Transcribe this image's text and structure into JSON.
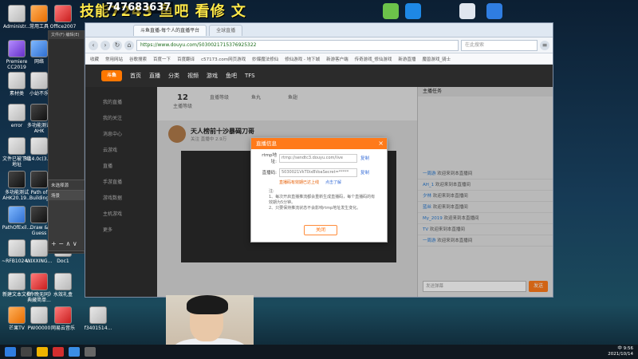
{
  "overlay": {
    "stream_title": "技能7243 鱼吧 看修 文",
    "qq_number": "747683637",
    "room_number": "82563"
  },
  "desktop_icons": [
    {
      "label": "Administr..."
    },
    {
      "label": "常用工具"
    },
    {
      "label": "Office2007"
    },
    {
      "label": "Premiere CC2019"
    },
    {
      "label": "网络"
    },
    {
      "label": "素材类"
    },
    {
      "label": "小幼不乐"
    },
    {
      "label": "error"
    },
    {
      "label": "多功能测试AHK"
    },
    {
      "label": "文件已被下载地址"
    },
    {
      "label": "3.14.0c(3.1...)"
    },
    {
      "label": "多功能测试AHK20.19..."
    },
    {
      "label": "Path of Building"
    },
    {
      "label": "PathOfExil..."
    },
    {
      "label": "Draw & Guess"
    },
    {
      "label": "~RFB1024..."
    },
    {
      "label": "WIXXING..."
    },
    {
      "label": "Doc1"
    },
    {
      "label": "新建文本文档"
    },
    {
      "label": "《今晚无同》典藏简单..."
    },
    {
      "label": "水效礼盒"
    },
    {
      "label": "芒果TV"
    },
    {
      "label": "PW00000"
    },
    {
      "label": "网易云音乐"
    },
    {
      "label": "f3401514..."
    }
  ],
  "browser": {
    "tabs": [
      "斗鱼直播-每个人的直播平台",
      "全球直播"
    ],
    "url": "https://www.douyu.com/5030021715376925322",
    "search_placeholder": "在此搜索",
    "bookmarks": [
      "收藏",
      "常用网站",
      "谷歌搜索",
      "百度一下",
      "百度翻译",
      "c57173.com网页游戏",
      "妙爆魔法修仙",
      "修仙游戏 - 地下城",
      "新游客户端",
      "传奇游戏_修仙游戏",
      "新游直播",
      "魔兽游戏_骑士"
    ]
  },
  "douyu": {
    "nav": [
      "首页",
      "直播",
      "分类",
      "视频",
      "游戏",
      "鱼吧",
      "TFS"
    ],
    "side": [
      "我的直播",
      "我的关注",
      "消息中心",
      "云游戏",
      "直播",
      "手游直播",
      "游戏数据",
      "主机游戏",
      "更多"
    ],
    "stats": [
      {
        "value": "12",
        "label": "主播等级"
      },
      {
        "value": "",
        "label": "直播等级"
      },
      {
        "value": "",
        "label": "鱼丸"
      },
      {
        "value": "",
        "label": "鱼翅"
      }
    ],
    "room_title": "天人榜前十沙暴碣刀哥",
    "room_sub": "关注 直播中 2.9万",
    "right_header": "主播任务",
    "chat": [
      {
        "user": "一周游",
        "msg": "欢迎来到本直播间"
      },
      {
        "user": "AH_1",
        "msg": "欢迎来到本直播间"
      },
      {
        "user": "夕林",
        "msg": "欢迎来到本直播间"
      },
      {
        "user": "蓝丝",
        "msg": "欢迎来到本直播间"
      },
      {
        "user": "My_2019",
        "msg": "欢迎来到本直播间"
      },
      {
        "user": "TV",
        "msg": "欢迎来到本直播间"
      },
      {
        "user": "一周游",
        "msg": "欢迎来到本直播间"
      }
    ],
    "chat_input_placeholder": "发送弹幕",
    "send_label": "发送"
  },
  "modal": {
    "title": "直播信息",
    "rtmp_label": "rtmp地址:",
    "rtmp_value": "rtmp://sendtc3.douyu.com/live",
    "key_label": "直播码:",
    "key_value": "5030021VkT0ixBVoaSecret=*****",
    "copy_label": "复制",
    "warn": "直播码有效期已达上线",
    "refresh": "点击了解",
    "notes": [
      "注:",
      "1、每次开启直播推流都会重新生成直播码，每个直播码的有效期为5分钟。",
      "2、只要保持推流状态不会影响rtmp地址发生变化。"
    ],
    "ok_label": "关闭"
  },
  "obs": {
    "scene_label": "未选择源",
    "source_label": "场景",
    "controls": "+ − ∧ ∨"
  },
  "taskbar": {
    "time": "9:56",
    "date": "2021/10/14",
    "lang": "中"
  }
}
